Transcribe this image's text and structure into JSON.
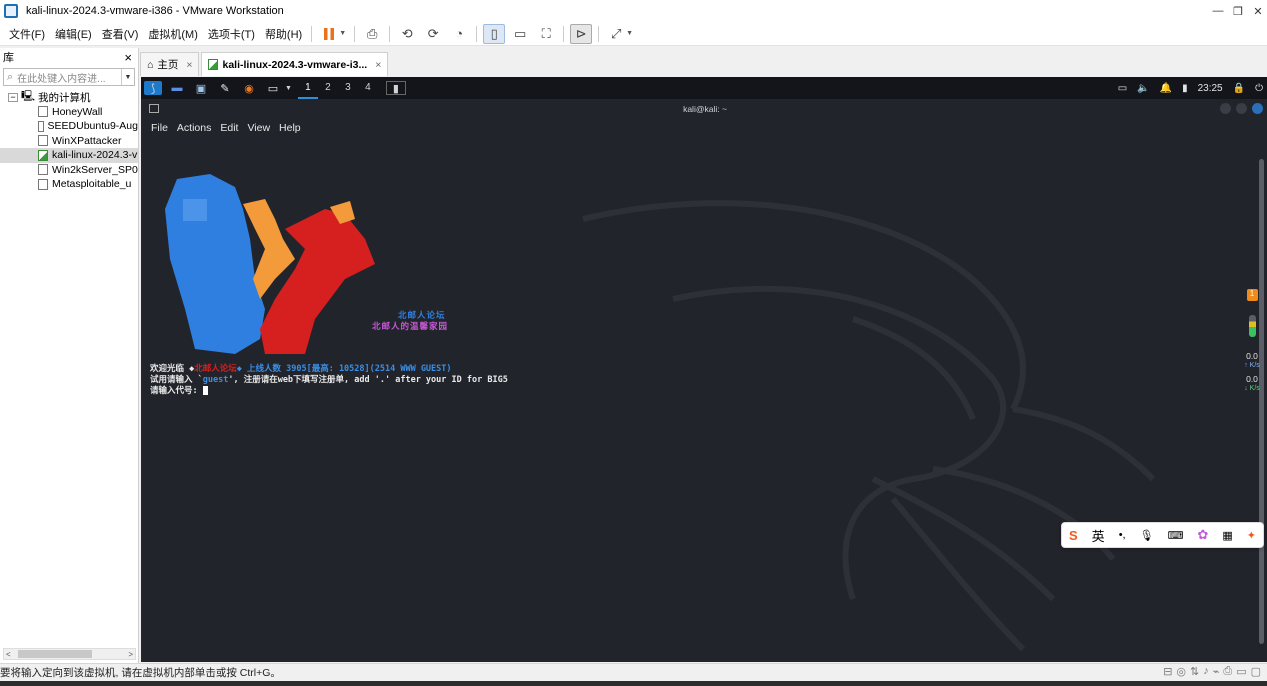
{
  "window": {
    "title": "kali-linux-2024.3-vmware-i386 - VMware Workstation"
  },
  "menu": [
    "文件(F)",
    "编辑(E)",
    "查看(V)",
    "虚拟机(M)",
    "选项卡(T)",
    "帮助(H)"
  ],
  "library": {
    "title": "库",
    "close": "×",
    "search_placeholder": "在此处键入内容进...",
    "root": "我的计算机",
    "vms": [
      "HoneyWall",
      "SEEDUbuntu9-Aug",
      "WinXPattacker",
      "kali-linux-2024.3-v",
      "Win2kServer_SP0",
      "Metasploitable_u"
    ]
  },
  "tabs": [
    {
      "label": "主页",
      "close": "×"
    },
    {
      "label": "kali-linux-2024.3-vmware-i3...",
      "close": "×"
    }
  ],
  "kali": {
    "workspaces": [
      "1",
      "2",
      "3",
      "4"
    ],
    "clock": "23:25",
    "term_title": "kali@kali: ~",
    "term_menu": [
      "File",
      "Actions",
      "Edit",
      "View",
      "Help"
    ],
    "forum_line1": "北邮人论坛",
    "forum_line2": "北邮人的温馨家园",
    "welcome_a": "欢迎光临 ◆",
    "welcome_b": "北邮人论坛",
    "welcome_c": "◆ 上线人数 3905[最高: 10528](2514 WWW GUEST)",
    "line2_a": "试用请输入 `",
    "line2_b": "guest",
    "line2_c": "', 注册请在web下填写注册单, add '.' after your ID for BIG5",
    "prompt": "请输入代号: ",
    "net_up": "0.0",
    "net_up_unit": "↑ K/s",
    "net_down": "0.0",
    "net_down_unit": "↓ K/s",
    "badge": "1"
  },
  "ime": {
    "lang": "英"
  },
  "status": {
    "text": "要将输入定向到该虚拟机, 请在虚拟机内部单击或按 Ctrl+G。"
  }
}
